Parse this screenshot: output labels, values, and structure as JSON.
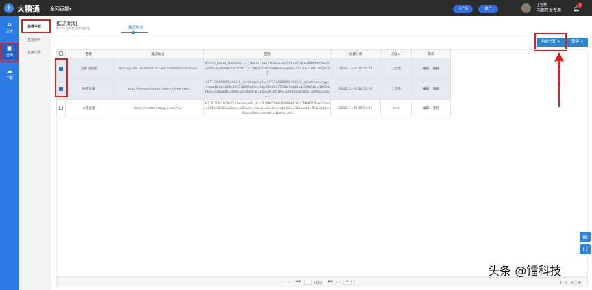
{
  "header": {
    "brand": "大鹏通",
    "platform": "全网直播▾",
    "btn1": "上广场",
    "btn2": "推广",
    "user_name": "上官燕",
    "user_org": "内部开发专用",
    "notification_count": "3"
  },
  "sidebar": {
    "items": [
      {
        "label": "主页",
        "icon": "⌂"
      },
      {
        "label": "全网",
        "icon": "▣"
      },
      {
        "label": "下载",
        "icon": "☁"
      }
    ]
  },
  "submenu": {
    "items": [
      "直播平台",
      "直播账号",
      "直播记录"
    ]
  },
  "page": {
    "title": "推流地址",
    "subtitle": "各个平台的推流地址管理",
    "tab": "推流地址",
    "assign_button": "地址分配 +",
    "new_button": "新建 +"
  },
  "table": {
    "headers": [
      "名称",
      "推流地址",
      "密钥",
      "创建时间",
      "创建人",
      "操作"
    ],
    "rows": [
      {
        "checked": true,
        "name": "百家号直播",
        "url": "rtmp://push1.liveshow.lss-user.baidubce.com/live/",
        "key": "stream_bduid_4033591231_7916013847?token=00c143202d09eb850db26d7c22afea7aa52e6f71cb64b72a3780ac0c6da2a86e&expire=2023-02-14T10:52:00Z",
        "time": "2022-12-16 10:56:05",
        "creator": "上官燕",
        "edit": "编辑",
        "del": "删除"
      },
      {
        "checked": true,
        "name": "映客直播",
        "url": "rtmp://live-push-zego.inke.cn/inkemain/",
        "key": "1671159090911934_0_en?stream_id=1671159090911934_0_en&stream_type=zego&uid=348409513&kProfile=3&kWidth=720&kHeight=1280&kBr=1800&kFps=15&pkBr=800&kEnableHD=1&kAACBitrate=128000&linkBr=800&cs265=1",
        "time": "2022-12-16 10:55:40",
        "creator": "上官燕",
        "edit": "编辑",
        "del": "删除"
      },
      {
        "checked": false,
        "name": "斗鱼直播",
        "url": "rtmp://sendtc3.douyu.com/live",
        "key": "6279757rCWOlvY2x?wsSecret=5ca7658bf29bb31dd9dd783274b951f&wsTime=639bd2b3&wsSeek=off&wm=0&tw=0&roirecognition=0&record=flv&origin=tct&txHost=sendtc3.douyu.com",
        "time": "2022-11-29 10:57:31",
        "creator": "test",
        "edit": "编辑",
        "del": "删除"
      }
    ]
  },
  "pager": {
    "first": "⏮",
    "prev": "◀◀",
    "page": "1",
    "total_pages": "共1页",
    "next": "▶▶",
    "last": "⏭",
    "page_size": "20 ∨",
    "summary": "1 - 3 · 共 3 条"
  },
  "watermark": "头条 @镭科技",
  "colors": {
    "sidebar": "#2d7be5",
    "topbar": "#2b2b2b",
    "accent": "#2d85d0",
    "highlight": "#e02020"
  }
}
